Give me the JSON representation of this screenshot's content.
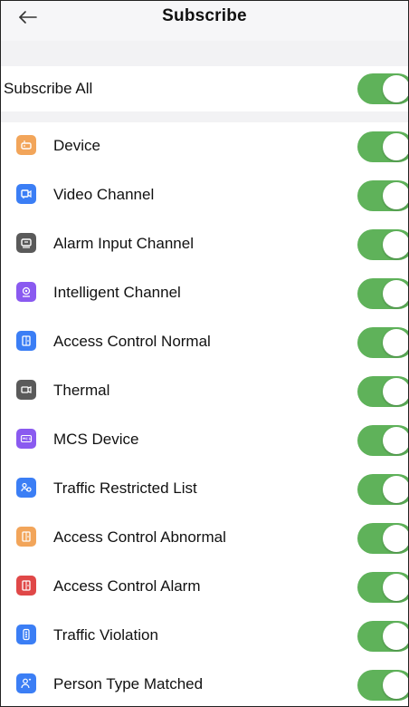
{
  "header": {
    "title": "Subscribe",
    "back_icon": "arrow-left-icon"
  },
  "subscribe_all": {
    "label": "Subscribe All",
    "on": true
  },
  "items": [
    {
      "label": "Device",
      "color": "#f2a55a",
      "icon": "device-icon",
      "on": true
    },
    {
      "label": "Video Channel",
      "color": "#3b7ef5",
      "icon": "video-channel-icon",
      "on": true
    },
    {
      "label": "Alarm Input Channel",
      "color": "#5a5a5a",
      "icon": "alarm-input-icon",
      "on": true
    },
    {
      "label": "Intelligent Channel",
      "color": "#8a5af0",
      "icon": "intelligent-channel-icon",
      "on": true
    },
    {
      "label": "Access Control Normal",
      "color": "#3b7ef5",
      "icon": "door-icon",
      "on": true
    },
    {
      "label": "Thermal",
      "color": "#5a5a5a",
      "icon": "thermal-camera-icon",
      "on": true
    },
    {
      "label": "MCS Device",
      "color": "#8a5af0",
      "icon": "mcs-device-icon",
      "on": true
    },
    {
      "label": "Traffic Restricted List",
      "color": "#3b7ef5",
      "icon": "people-icon",
      "on": true
    },
    {
      "label": "Access Control Abnormal",
      "color": "#f2a55a",
      "icon": "door-icon",
      "on": true
    },
    {
      "label": "Access Control Alarm",
      "color": "#e04848",
      "icon": "door-icon",
      "on": true
    },
    {
      "label": "Traffic Violation",
      "color": "#3b7ef5",
      "icon": "traffic-light-icon",
      "on": true
    },
    {
      "label": "Person Type Matched",
      "color": "#3b7ef5",
      "icon": "person-icon",
      "on": true
    }
  ]
}
